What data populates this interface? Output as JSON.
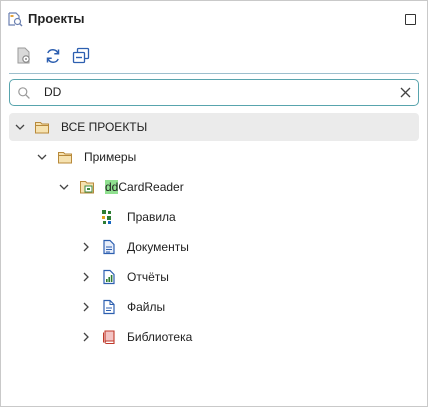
{
  "panel": {
    "title": "Проекты",
    "title_icon": "project-search-icon",
    "maximize_icon": "maximize-icon"
  },
  "toolbar": {
    "buttons": [
      {
        "name": "open-document-button",
        "icon": "document-gear-icon"
      },
      {
        "name": "refresh-button",
        "icon": "refresh-icon"
      },
      {
        "name": "collapse-all-button",
        "icon": "collapse-all-icon"
      }
    ]
  },
  "search": {
    "value": "DD",
    "placeholder": "",
    "search_icon": "search-icon",
    "clear_icon": "clear-icon"
  },
  "tree": {
    "root": {
      "label": "ВСЕ ПРОЕКТЫ",
      "expanded": true,
      "selected": true
    },
    "examples": {
      "label": "Примеры",
      "expanded": true
    },
    "project": {
      "match": "dd",
      "rest": "CardReader",
      "expanded": true
    },
    "items": [
      {
        "label": "Правила",
        "icon": "rules-icon",
        "expandable": false
      },
      {
        "label": "Документы",
        "icon": "documents-icon",
        "expandable": true
      },
      {
        "label": "Отчёты",
        "icon": "reports-icon",
        "expandable": true
      },
      {
        "label": "Файлы",
        "icon": "files-icon",
        "expandable": true
      },
      {
        "label": "Библиотека",
        "icon": "library-icon",
        "expandable": true
      }
    ]
  },
  "colors": {
    "accent": "#58a4ad",
    "match_highlight": "#8fe08f",
    "folder": "#e8c886",
    "selection": "#ebebeb",
    "icon_blue": "#2d5fb0"
  }
}
